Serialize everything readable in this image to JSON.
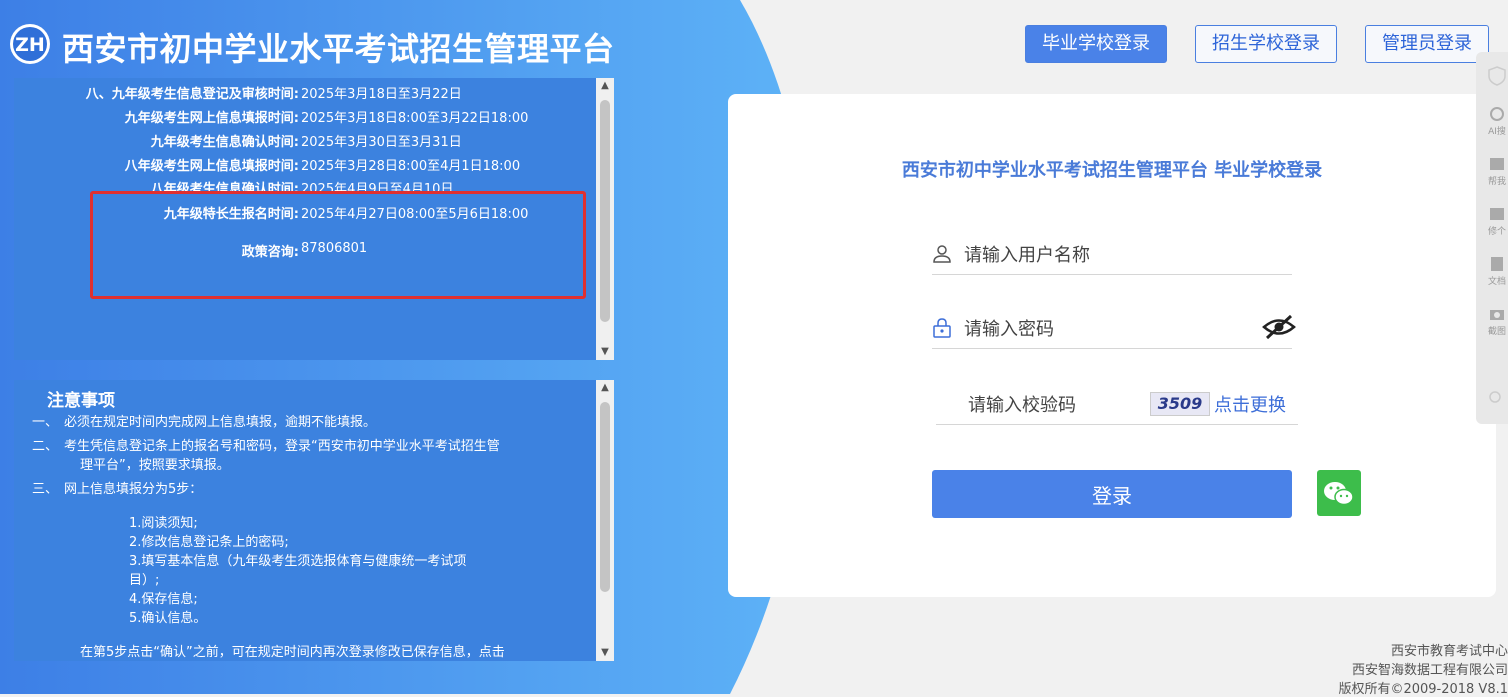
{
  "header": {
    "platform_title": "西安市初中学业水平考试招生管理平台",
    "logo_text": "ZH"
  },
  "nav": {
    "grad_school_login": "毕业学校登录",
    "enroll_school_login": "招生学校登录",
    "admin_login": "管理员登录"
  },
  "schedule": {
    "rows": [
      {
        "label": "八、九年级考生信息登记及审核时间:",
        "value": "2025年3月18日至3月22日"
      },
      {
        "label": "九年级考生网上信息填报时间:",
        "value": "2025年3月18日8:00至3月22日18:00"
      },
      {
        "label": "九年级考生信息确认时间:",
        "value": "2025年3月30日至3月31日"
      },
      {
        "label": "八年级考生网上信息填报时间:",
        "value": "2025年3月28日8:00至4月1日18:00"
      },
      {
        "label": "八年级考生信息确认时间:",
        "value": "2025年4月9日至4月10日"
      },
      {
        "label": "九年级特长生报名时间:",
        "value": "2025年4月27日08:00至5月6日18:00"
      },
      {
        "label": "政策咨询:",
        "value": "87806801"
      }
    ]
  },
  "notice": {
    "title": "注意事项",
    "items": [
      {
        "num": "一、",
        "text": "必须在规定时间内完成网上信息填报，逾期不能填报。"
      },
      {
        "num": "二、",
        "text": "考生凭信息登记条上的报名号和密码，登录“西安市初中学业水平考试招生管"
      },
      {
        "num": "",
        "text": "理平台”，按照要求填报。"
      },
      {
        "num": "三、",
        "text": "网上信息填报分为5步："
      }
    ],
    "steps": [
      "1.阅读须知;",
      "2.修改信息登记条上的密码;",
      "3.填写基本信息（九年级考生须选报体育与健康统一考试项",
      "目）;",
      "4.保存信息;",
      "5.确认信息。"
    ],
    "footer_text": "在第5步点击“确认”之前，可在规定时间内再次登录修改已保存信息，点击"
  },
  "login": {
    "title": "西安市初中学业水平考试招生管理平台 毕业学校登录",
    "username_placeholder": "请输入用户名称",
    "password_placeholder": "请输入密码",
    "captcha_placeholder": "请输入校验码",
    "captcha_code": "3509",
    "captcha_refresh": "点击更换",
    "submit_label": "登录"
  },
  "side_tools": {
    "items": [
      "AI搜",
      "帮我",
      "修个",
      "文档",
      "截图"
    ]
  },
  "footer": {
    "line1": "西安市教育考试中心",
    "line2": "西安智海数据工程有限公司",
    "line3": "版权所有©2009-2018 V8.1"
  },
  "colors": {
    "brand_blue": "#4a82e8",
    "panel_blue": "#3c82df",
    "highlight_red": "#e03030",
    "wechat_green": "#3dbd4b"
  }
}
